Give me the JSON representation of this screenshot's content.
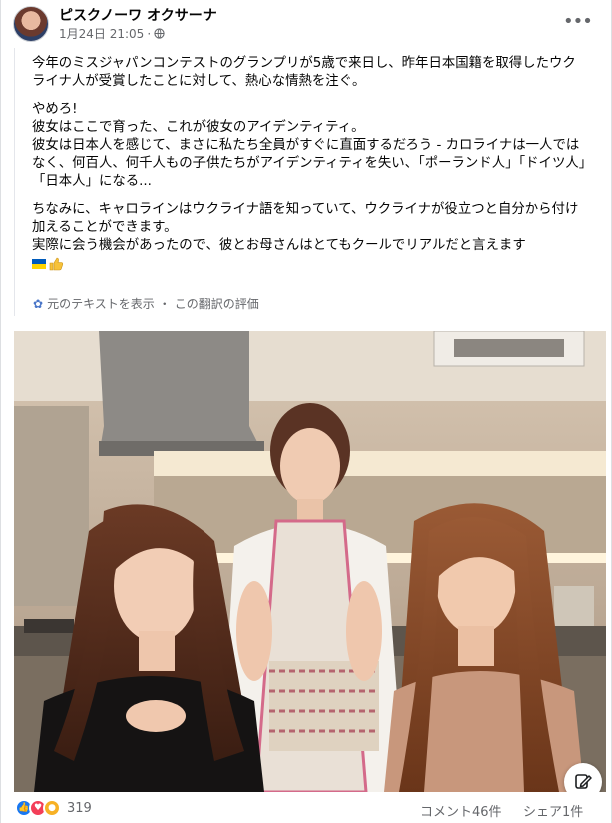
{
  "post": {
    "author": "ピスクノーワ オクサーナ",
    "timestamp": "1月24日 21:05",
    "privacy_icon": "globe-icon",
    "menu_icon": "more-horizontal-icon"
  },
  "body": {
    "paragraph1": "今年のミスジャパンコンテストのグランプリが5歳で来日し、昨年日本国籍を取得したウクライナ人が受賞したことに対して、熱心な情熱を注ぐ。",
    "para2_line1": "やめろ!",
    "para2_line2": "彼女はここで育った、これが彼女のアイデンティティ。",
    "para2_line3": "彼女は日本人を感じて、まさに私たち全員がすぐに直面するだろう - カロライナは一人ではなく、何百人、何千人もの子供たちがアイデンティティを失い、「ポーランド人」「ドイツ人」「日本人」になる...",
    "para3_line1": "ちなみに、キャロラインはウクライナ語を知っていて、ウクライナが役立つと自分から付け加えることができます。",
    "para3_line2": "実際に会う機会があったので、彼とお母さんはとてもクールでリアルだと言えます",
    "emojis": [
      "flag-ukraine-icon",
      "thumbs-up-icon"
    ]
  },
  "translation": {
    "show_original": "元のテキストを表示",
    "separator": "・",
    "rate": "この翻訳の評価"
  },
  "photo": {
    "edit_icon": "edit-pencil-icon"
  },
  "footer": {
    "reaction_icons": [
      "like-icon",
      "love-icon",
      "care-icon"
    ],
    "reaction_count": "319",
    "comments": "コメント46件",
    "shares": "シェア1件"
  },
  "colors": {
    "link": "#65676b",
    "like": "#1877f2",
    "love": "#f33e58",
    "care": "#f7b125"
  }
}
